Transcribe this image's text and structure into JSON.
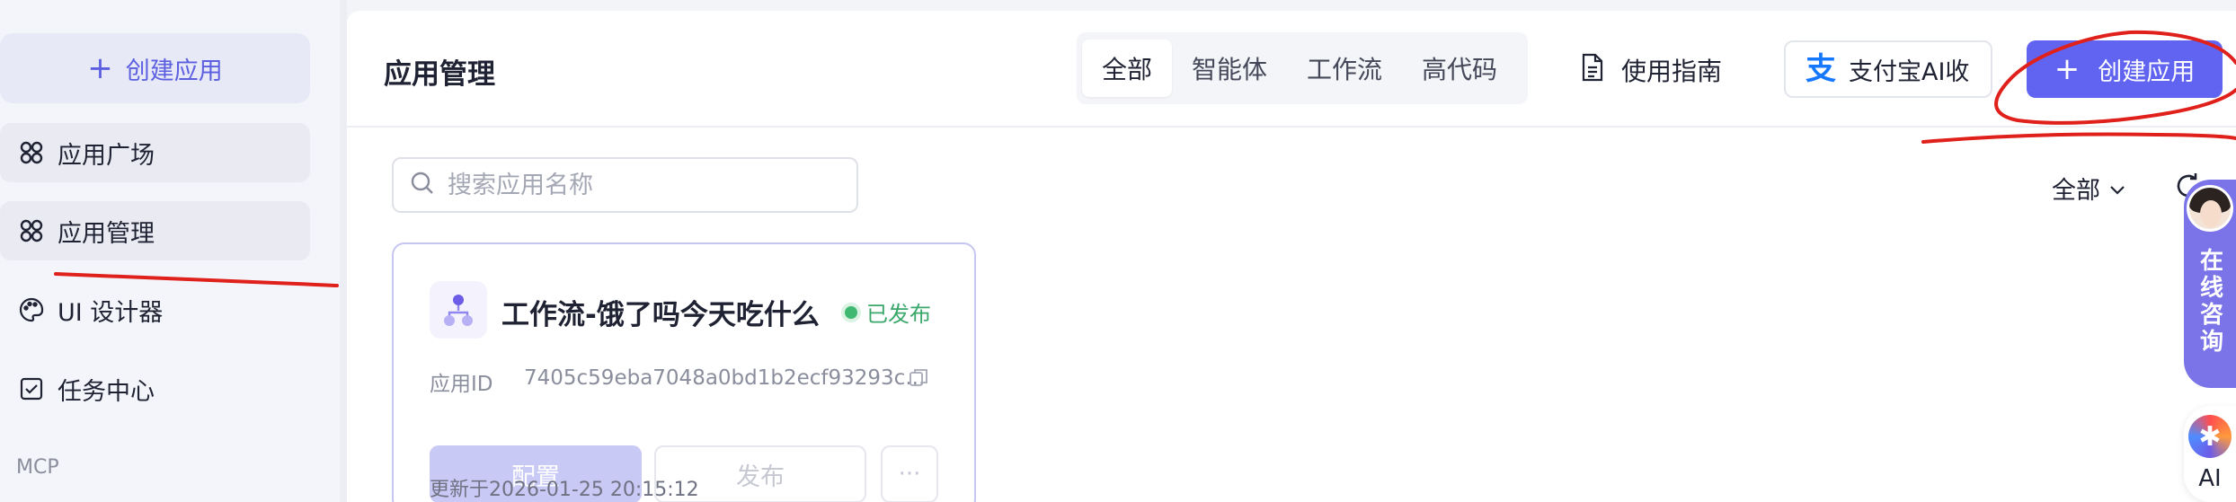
{
  "sidebar": {
    "create_label": "创建应用",
    "items": [
      {
        "label": "应用广场"
      },
      {
        "label": "应用管理"
      },
      {
        "label": "UI 设计器"
      },
      {
        "label": "任务中心"
      }
    ],
    "section_label": "MCP"
  },
  "header": {
    "title": "应用管理",
    "tabs": [
      "全部",
      "智能体",
      "工作流",
      "高代码"
    ],
    "active_tab": "全部",
    "guide_label": "使用指南",
    "alipay_label": "支付宝AI收",
    "create_label": "创建应用"
  },
  "toolbar": {
    "search_placeholder": "搜索应用名称",
    "filter_label": "全部"
  },
  "card": {
    "title": "工作流-饿了吗今天吃什么",
    "status": "已发布",
    "app_id_label": "应用ID",
    "app_id_value": "7405c59eba7048a0bd1b2ecf93293c...",
    "config_label": "配置",
    "publish_label": "发布",
    "more_label": "···",
    "updated": "更新于2026-01-25 20:15:12"
  },
  "float": {
    "consult_label": "在线咨询",
    "ai_label": "AI"
  },
  "colors": {
    "accent": "#6164f0",
    "status_green": "#3aa86a",
    "annotation_red": "#e0201b"
  }
}
